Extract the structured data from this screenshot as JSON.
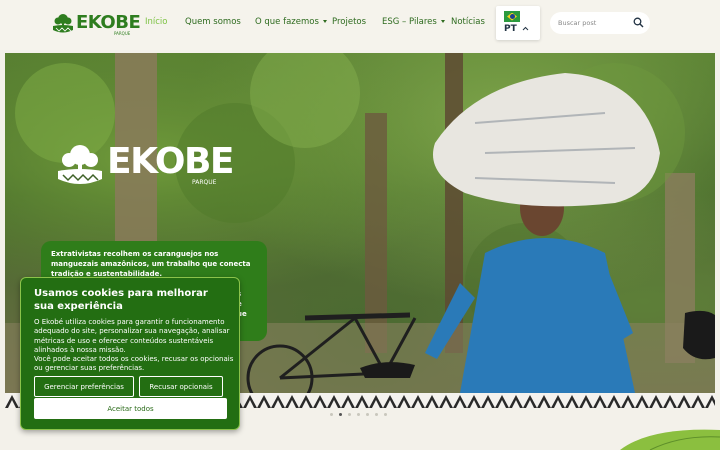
{
  "brand": {
    "name": "EKOBE",
    "sub": "PARQUE"
  },
  "nav": {
    "items": [
      {
        "label": "Início",
        "active": true,
        "dropdown": false
      },
      {
        "label": "Quem somos",
        "active": false,
        "dropdown": false
      },
      {
        "label": "O que fazemos",
        "active": false,
        "dropdown": true
      },
      {
        "label": "Projetos",
        "active": false,
        "dropdown": false
      },
      {
        "label": "ESG – Pilares",
        "active": false,
        "dropdown": true
      },
      {
        "label": "Notícias",
        "active": false,
        "dropdown": false
      }
    ]
  },
  "language": {
    "code": "PT",
    "flag_icon": "brazil-flag-icon"
  },
  "search": {
    "placeholder": "Buscar post",
    "icon": "search-icon"
  },
  "hero": {
    "caption": "Extrativistas recolhem os caranguejos nos manguezais amazônicos, um trabalho que conecta tradição e sustentabilidade.",
    "caption_overflow": [
      "s",
      "e",
      "ue"
    ],
    "slides_total": 7,
    "active_slide": 2
  },
  "cookie": {
    "title": "Usamos cookies para melhorar sua experiência",
    "body": "O Ekobé utiliza cookies para garantir o funcionamento adequado do site, personalizar sua navegação, analisar métricas de uso e oferecer conteúdos sustentáveis alinhados à nossa missão.",
    "body2": "Você pode aceitar todos os cookies, recusar os opcionais ou gerenciar suas preferências.",
    "manage_label": "Gerenciar preferências",
    "refuse_label": "Recusar opcionais",
    "accept_label": "Aceitar todos"
  },
  "colors": {
    "brand_green": "#2e7d1f",
    "nav_active": "#7cc242",
    "cookie_bg": "#236e12",
    "page_bg": "#f3f1ea"
  }
}
